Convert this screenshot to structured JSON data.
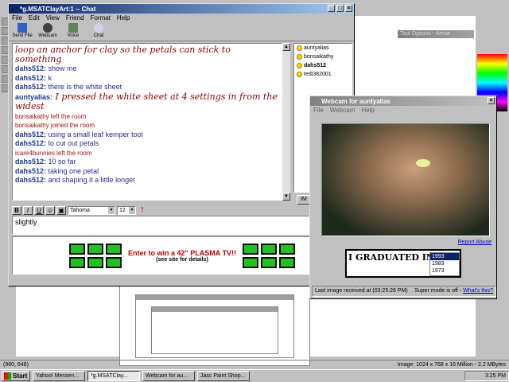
{
  "psp": {
    "tool_options_title": "Tool Options - Arrow",
    "status_coords": "(980, 648)",
    "status_image_info": "Image: 1024 x 768 x 16 Million - 2.2 MBytes"
  },
  "chat": {
    "title": "*g.MSATClayArt:1 -- Chat",
    "menu": [
      "File",
      "Edit",
      "View",
      "Friend",
      "Format",
      "Help"
    ],
    "toolbar": [
      "Send File",
      "Webcam",
      "Voice",
      "Chat"
    ],
    "messages": [
      {
        "kind": "big",
        "user": "",
        "text": "loop an anchor for clay so the petals can stick to something"
      },
      {
        "kind": "msg",
        "user": "dahs512:",
        "text": " show me"
      },
      {
        "kind": "msg",
        "user": "dahs512:",
        "text": " k"
      },
      {
        "kind": "msg",
        "user": "dahs512:",
        "text": " there is the white sheet"
      },
      {
        "kind": "bigmsg",
        "user": "auntyalias:",
        "text": " I pressed the white sheet at 4 settings in from the widest"
      },
      {
        "kind": "sys",
        "user": "",
        "text": "bonsaikathy left the room"
      },
      {
        "kind": "sys",
        "user": "",
        "text": "bonsaikathy joined the room"
      },
      {
        "kind": "msg",
        "user": "dahs512:",
        "text": " using a small leaf kemper tool"
      },
      {
        "kind": "msg",
        "user": "dahs512:",
        "text": " to cut out petals"
      },
      {
        "kind": "sys",
        "user": "",
        "text": "icare4bunnies left the room"
      },
      {
        "kind": "msg",
        "user": "dahs512:",
        "text": " 10 so far"
      },
      {
        "kind": "msg",
        "user": "dahs512:",
        "text": " taking one petal"
      },
      {
        "kind": "msg",
        "user": "dahs512:",
        "text": " and shaping it a little longer"
      }
    ],
    "users": [
      "auntyalias",
      "bonsaikathy",
      "dahs512",
      "tedi382001"
    ],
    "im_label": "IM",
    "format": {
      "bold": "B",
      "italic": "I",
      "underline": "U",
      "font": "Tahoma",
      "size": "12"
    },
    "input_text": "slightly",
    "ad": {
      "headline": "Enter to win a 42\" PLASMA TV!!",
      "sub": "(see site for details)"
    }
  },
  "webcam": {
    "title": "Webcam for auntyalias",
    "menu": [
      "File",
      "Webcam",
      "Help"
    ],
    "report_abuse": "Report Abuse",
    "grad_title": "I GRADUATED IN:",
    "years": [
      "1993",
      "1983",
      "1973"
    ],
    "last_image": "Last image received at (03:25:26 PM)",
    "super_mode": "Super mode is off -",
    "whats_this": "What's this?"
  },
  "taskbar": {
    "start": "Start",
    "tasks": [
      "Yahoo! Messen...",
      "*g.MSATClay...",
      "Webcam for au...",
      "Jasc Paint Shop..."
    ],
    "clock": "3:25 PM"
  }
}
